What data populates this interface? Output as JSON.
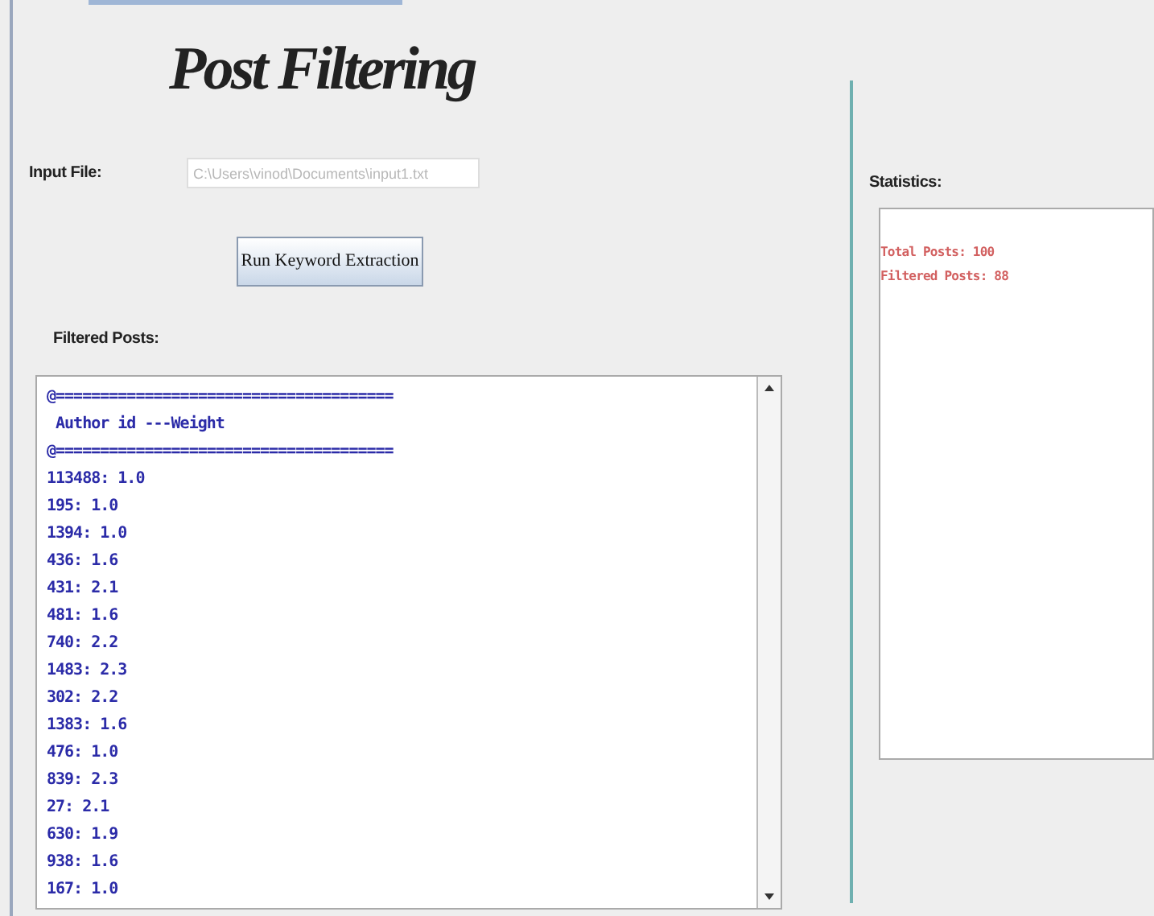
{
  "title": "Post Filtering",
  "input_file": {
    "label": "Input File:",
    "value": "C:\\Users\\vinod\\Documents\\input1.txt"
  },
  "run_button": {
    "label": "Run Keyword Extraction"
  },
  "filtered_posts": {
    "label": "Filtered Posts:",
    "lines": [
      "@======================================",
      " Author id ---Weight",
      "@======================================",
      "113488: 1.0",
      "195: 1.0",
      "1394: 1.0",
      "436: 1.6",
      "431: 2.1",
      "481: 1.6",
      "740: 2.2",
      "1483: 2.3",
      "302: 2.2",
      "1383: 1.6",
      "476: 1.0",
      "839: 2.3",
      "27: 2.1",
      "630: 1.9",
      "938: 1.6",
      "167: 1.0"
    ]
  },
  "statistics": {
    "label": "Statistics:",
    "lines": [
      "Total Posts: 100",
      "Filtered Posts: 88"
    ]
  }
}
